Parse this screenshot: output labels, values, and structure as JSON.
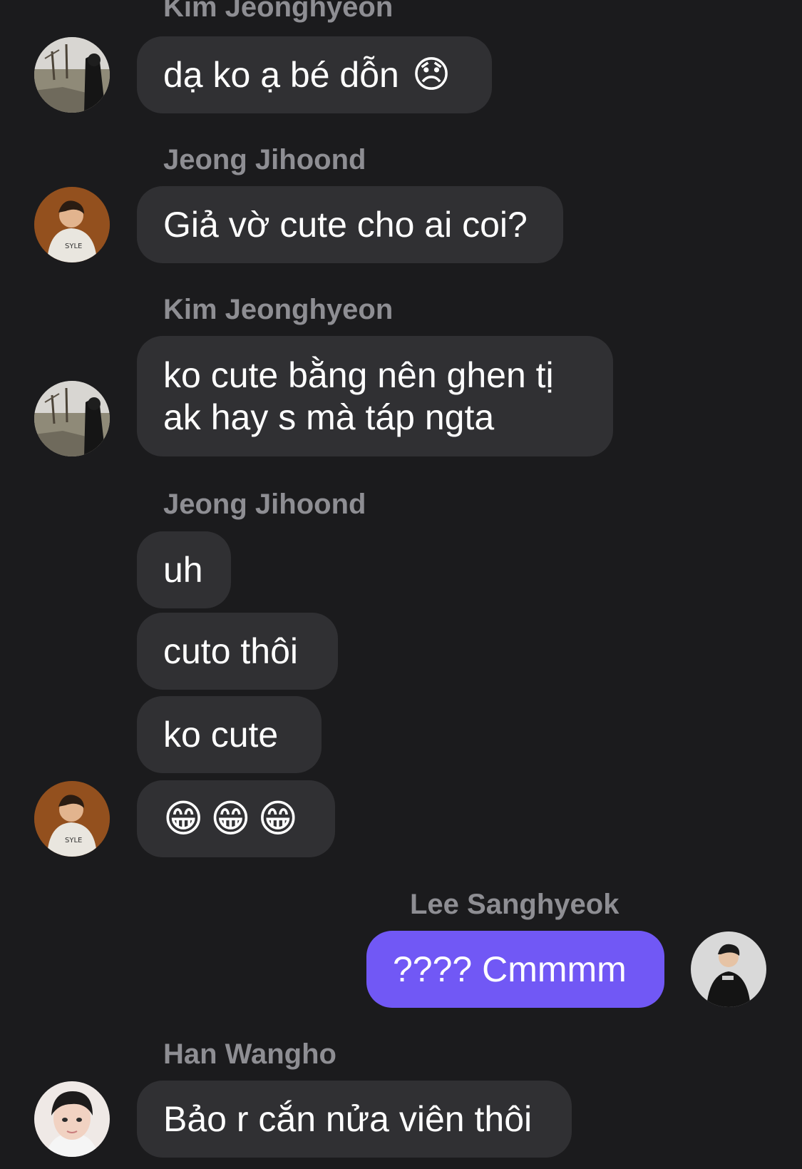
{
  "messages": [
    {
      "sender": "Kim Jeonghyeon",
      "text": "dạ ko ạ bé dỗn",
      "emoji": "😞"
    },
    {
      "sender": "Jeong Jihoond",
      "text": "Giả vờ cute cho ai coi?"
    },
    {
      "sender": "Kim Jeonghyeon",
      "lines": [
        "ko cute bằng nên ghen tị",
        "ak hay s mà táp ngta"
      ]
    },
    {
      "sender": "Jeong Jihoond",
      "texts": [
        "uh",
        "cuto thôi",
        "ko cute"
      ],
      "emojis": [
        "😁",
        "😁",
        "😁"
      ]
    },
    {
      "sender": "Lee Sanghyeok",
      "text": "???? Cmmmm"
    },
    {
      "sender": "Han Wangho",
      "text": "Bảo r cắn nửa viên thôi"
    }
  ],
  "colors": {
    "background": "#1b1b1d",
    "incoming_bubble": "#303033",
    "outgoing_bubble": "#7158f5",
    "sender_name": "#8e8e93"
  },
  "avatars": [
    "landscape-avatar-icon",
    "portrait-avatar-icon",
    "portrait-avatar-icon",
    "portrait-avatar-icon"
  ]
}
